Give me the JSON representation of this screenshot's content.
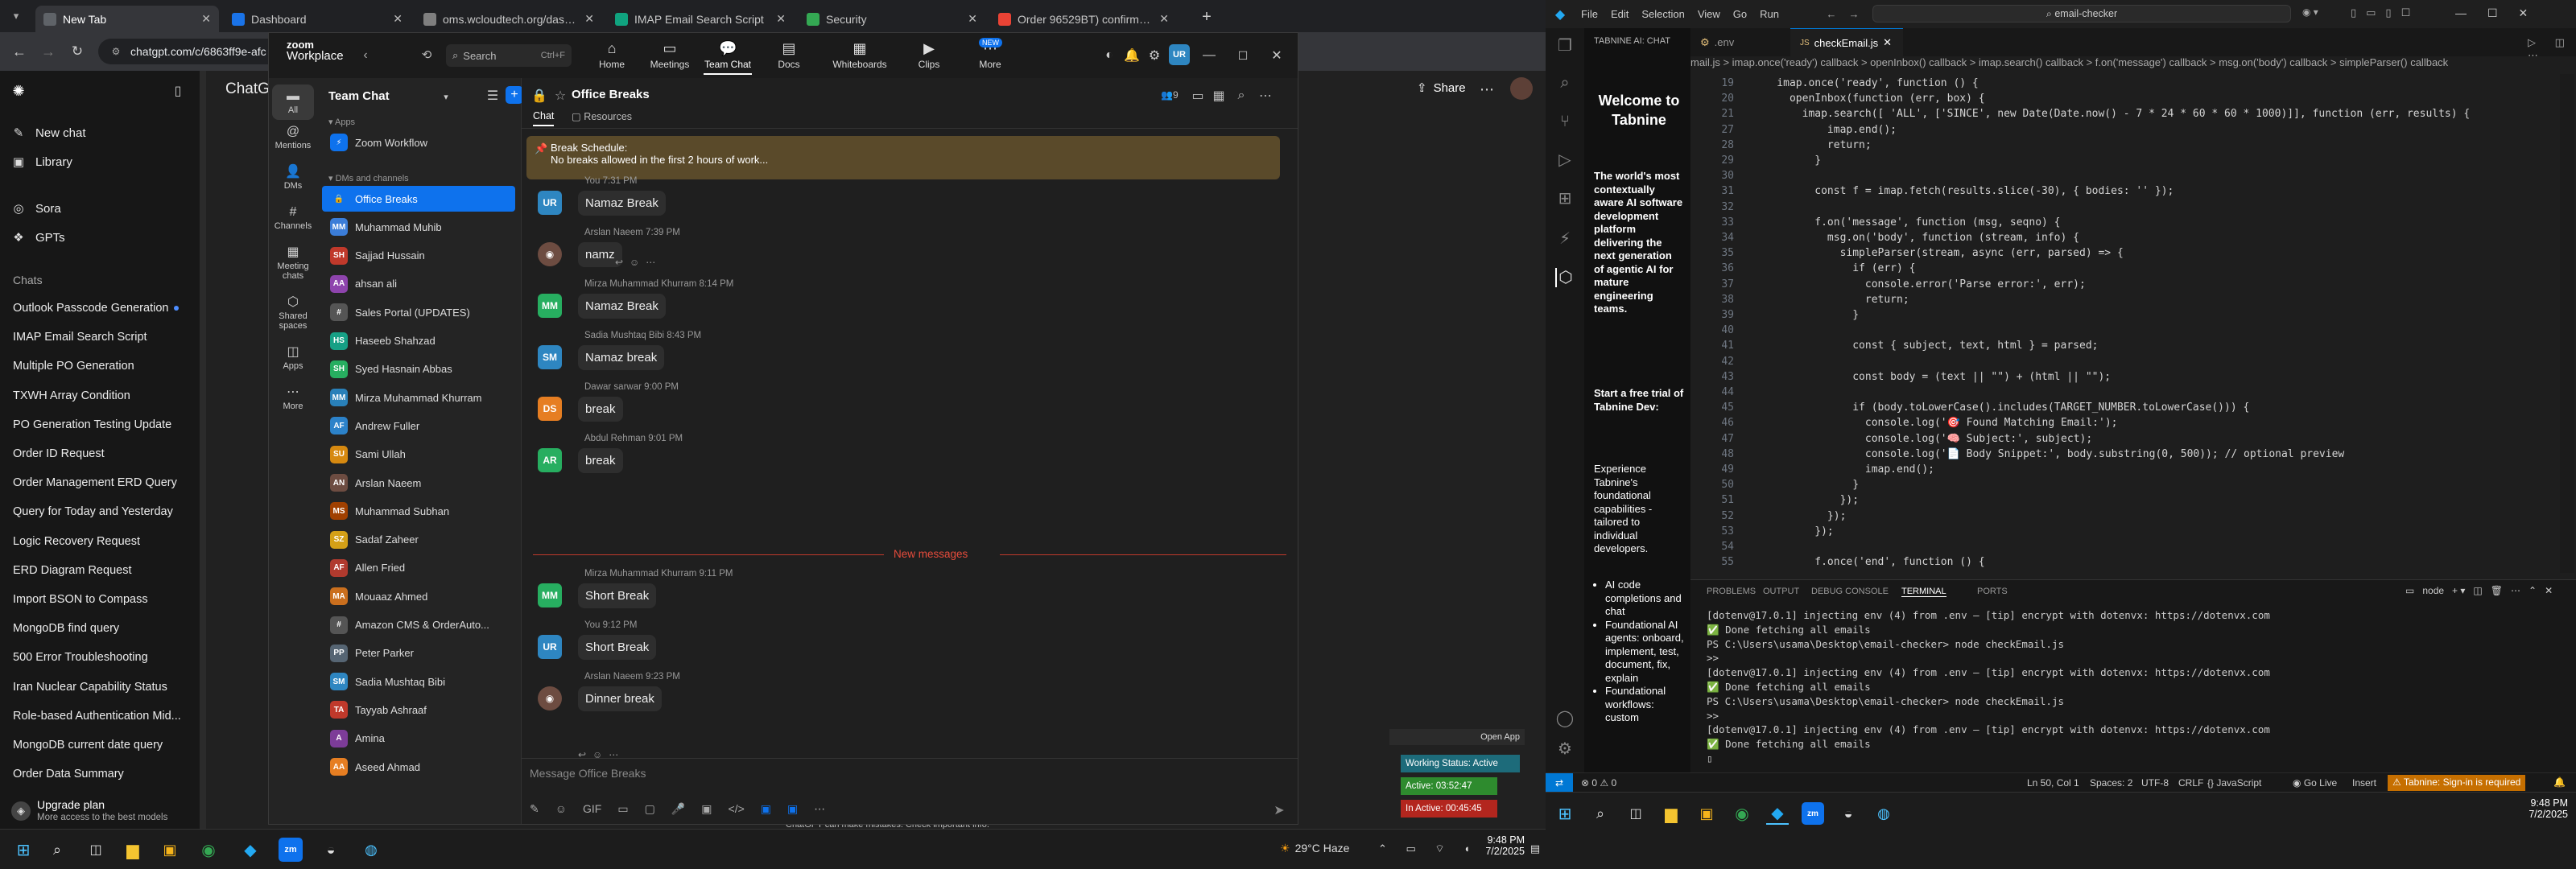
{
  "browser": {
    "tabs": [
      {
        "title": "New Tab",
        "color": "#5f6368"
      },
      {
        "title": "Dashboard",
        "color": "#1a73e8"
      },
      {
        "title": "oms.wcloudtech.org/dashboard",
        "color": "#7f7f7f"
      },
      {
        "title": "IMAP Email Search Script",
        "color": "#10a37f"
      },
      {
        "title": "Security",
        "color": "#34a853"
      },
      {
        "title": "Order 96529BT) confirmed - us",
        "color": "#ea4335"
      }
    ],
    "url": "chatgpt.com/c/6863ff9e-afc"
  },
  "chatgpt": {
    "brand": "ChatG",
    "new_chat": "New chat",
    "library": "Library",
    "sora": "Sora",
    "gpts": "GPTs",
    "chats_heading": "Chats",
    "history": [
      "Outlook Passcode Generation",
      "IMAP Email Search Script",
      "Multiple PO Generation",
      "TXWH Array Condition",
      "PO Generation Testing Update",
      "Order ID Request",
      "Order Management ERD Query",
      "Query for Today and Yesterday",
      "Logic Recovery Request",
      "ERD Diagram Request",
      "Import BSON to Compass",
      "MongoDB find query",
      "500 Error Troubleshooting",
      "Iran Nuclear Capability Status",
      "Role-based Authentication Mid...",
      "MongoDB current date query",
      "Order Data Summary"
    ],
    "upgrade_title": "Upgrade plan",
    "upgrade_sub": "More access to the best models",
    "share": "Share",
    "disclaimer": "ChatGPT can make mistakes. Check important info."
  },
  "zoom": {
    "logo_line1": "zoom",
    "logo_line2": "Workplace",
    "search_placeholder": "Search",
    "search_shortcut": "Ctrl+F",
    "nav": [
      "Home",
      "Meetings",
      "Team Chat",
      "Docs",
      "Whiteboards",
      "Clips",
      "More"
    ],
    "new_badge": "NEW",
    "avatar": "UR",
    "rail": [
      "All",
      "Mentions",
      "DMs",
      "Channels",
      "Meeting chats",
      "Shared spaces",
      "Apps",
      "More"
    ],
    "list_title": "Team Chat",
    "sections": {
      "apps": "Apps",
      "dms": "DMs and channels"
    },
    "app_items": [
      {
        "name": "Zoom Workflow",
        "initials": "",
        "color": "#0e72ed"
      }
    ],
    "contacts": [
      {
        "name": "Office Breaks",
        "initials": "",
        "color": "#0e72ed"
      },
      {
        "name": "Muhammad Muhib",
        "initials": "MM",
        "color": "#3b7dd8"
      },
      {
        "name": "Sajjad Hussain",
        "initials": "SH",
        "color": "#c0392b"
      },
      {
        "name": "ahsan ali",
        "initials": "AA",
        "color": "#8e44ad"
      },
      {
        "name": "Sales Portal (UPDATES)",
        "initials": "",
        "color": "#555"
      },
      {
        "name": "Haseeb Shahzad",
        "initials": "HS",
        "color": "#16a085"
      },
      {
        "name": "Syed Hasnain Abbas",
        "initials": "SH",
        "color": "#27ae60"
      },
      {
        "name": "Mirza Muhammad Khurram",
        "initials": "MM",
        "color": "#2980b9"
      },
      {
        "name": "Andrew Fuller",
        "initials": "AF",
        "color": "#2c82c9"
      },
      {
        "name": "Sami Ullah",
        "initials": "SU",
        "color": "#d68910"
      },
      {
        "name": "Arslan Naeem",
        "initials": "AN",
        "color": "#6d4c41"
      },
      {
        "name": "Muhammad Subhan",
        "initials": "MS",
        "color": "#a04000"
      },
      {
        "name": "Sadaf Zaheer",
        "initials": "SZ",
        "color": "#d4a017"
      },
      {
        "name": "Allen Fried",
        "initials": "AF",
        "color": "#b03a2e"
      },
      {
        "name": "Mouaaz Ahmed",
        "initials": "MA",
        "color": "#ca6f1e"
      },
      {
        "name": "Amazon CMS & OrderAuto...",
        "initials": "",
        "color": "#555"
      },
      {
        "name": "Peter Parker",
        "initials": "PP",
        "color": "#566573"
      },
      {
        "name": "Sadia Mushtaq Bibi",
        "initials": "SM",
        "color": "#2e86c1"
      },
      {
        "name": "Tayyab Ashraaf",
        "initials": "TA",
        "color": "#c0392b"
      },
      {
        "name": "Amina",
        "initials": "A",
        "color": "#7d3c98"
      },
      {
        "name": "Aseed Ahmad",
        "initials": "AA",
        "color": "#e67e22"
      }
    ],
    "chat_title": "Office Breaks",
    "member_count": "9",
    "chat_tabs": [
      "Chat",
      "Resources"
    ],
    "banner_title": "Break Schedule:",
    "banner_text": "No breaks allowed in the first 2 hours of work...",
    "messages": [
      {
        "who": "You 7:31 PM",
        "text": "Namaz Break",
        "initials": "UR",
        "color": "#2e86c1"
      },
      {
        "who": "Arslan Naeem 7:39 PM",
        "text": "namz",
        "initials": "",
        "color": "#6d4c41"
      },
      {
        "who": "Mirza Muhammad Khurram 8:14 PM",
        "text": "Namaz Break",
        "initials": "MM",
        "color": "#27ae60"
      },
      {
        "who": "Sadia Mushtaq Bibi 8:43 PM",
        "text": "Namaz break",
        "initials": "SM",
        "color": "#2e86c1"
      },
      {
        "who": "Dawar sarwar 9:00 PM",
        "text": "break",
        "initials": "DS",
        "color": "#e67e22"
      },
      {
        "who": "Abdul Rehman 9:01 PM",
        "text": "break",
        "initials": "AR",
        "color": "#27ae60"
      },
      {
        "who": "Mirza Muhammad Khurram 9:11 PM",
        "text": "Short Break",
        "initials": "MM",
        "color": "#27ae60"
      },
      {
        "who": "You 9:12 PM",
        "text": "Short Break",
        "initials": "UR",
        "color": "#2e86c1"
      },
      {
        "who": "Arslan Naeem 9:23 PM",
        "text": "Dinner break",
        "initials": "",
        "color": "#6d4c41"
      }
    ],
    "new_messages": "New messages",
    "compose_placeholder": "Message Office Breaks"
  },
  "overlay": {
    "open_app": "Open App",
    "working_status": "Working Status: Active",
    "active": "Active: 03:52:47",
    "in_active": "In Active: 00:45:45"
  },
  "taskbar_left": {
    "weather": "29°C  Haze",
    "time": "9:48 PM",
    "date": "7/2/2025"
  },
  "vscode": {
    "menu": [
      "File",
      "Edit",
      "Selection",
      "View",
      "Go",
      "Run"
    ],
    "search": "email-checker",
    "tabnine_tab": "TABNINE AI: CHAT",
    "tabs": [
      ".env",
      "checkEmail.js"
    ],
    "breadcrumb": "mail.js > imap.once('ready') callback > openInbox() callback > imap.search() callback > f.on('message') callback > msg.on('body') callback > simpleParser() callback",
    "tabnine": {
      "welcome": "Welcome to Tabnine",
      "pitch": "The world's most contextually aware AI software development platform delivering the next generation of agentic AI for mature engineering teams.",
      "trial": "Start a free trial of Tabnine Dev:",
      "experience": "Experience Tabnine's foundational capabilities - tailored to individual developers.",
      "bullets": [
        "AI code completions and chat",
        "Foundational AI agents: onboard, implement, test, document, fix, explain",
        "Foundational workflows: custom"
      ]
    },
    "code": [
      {
        "n": "19",
        "t": "    imap.once('ready', function () {"
      },
      {
        "n": "20",
        "t": "      openInbox(function (err, box) {"
      },
      {
        "n": "21",
        "t": "        imap.search([ 'ALL', ['SINCE', new Date(Date.now() - 7 * 24 * 60 * 60 * 1000)]], function (err, results) {"
      },
      {
        "n": "27",
        "t": "            imap.end();"
      },
      {
        "n": "28",
        "t": "            return;"
      },
      {
        "n": "29",
        "t": "          }"
      },
      {
        "n": "30",
        "t": ""
      },
      {
        "n": "31",
        "t": "          const f = imap.fetch(results.slice(-30), { bodies: '' });"
      },
      {
        "n": "32",
        "t": ""
      },
      {
        "n": "33",
        "t": "          f.on('message', function (msg, seqno) {"
      },
      {
        "n": "34",
        "t": "            msg.on('body', function (stream, info) {"
      },
      {
        "n": "35",
        "t": "              simpleParser(stream, async (err, parsed) => {"
      },
      {
        "n": "36",
        "t": "                if (err) {"
      },
      {
        "n": "37",
        "t": "                  console.error('Parse error:', err);"
      },
      {
        "n": "38",
        "t": "                  return;"
      },
      {
        "n": "39",
        "t": "                }"
      },
      {
        "n": "40",
        "t": ""
      },
      {
        "n": "41",
        "t": "                const { subject, text, html } = parsed;"
      },
      {
        "n": "42",
        "t": ""
      },
      {
        "n": "43",
        "t": "                const body = (text || \"\") + (html || \"\");"
      },
      {
        "n": "44",
        "t": ""
      },
      {
        "n": "45",
        "t": "                if (body.toLowerCase().includes(TARGET_NUMBER.toLowerCase())) {"
      },
      {
        "n": "46",
        "t": "                  console.log('🎯 Found Matching Email:');"
      },
      {
        "n": "47",
        "t": "                  console.log('🧠 Subject:', subject);"
      },
      {
        "n": "48",
        "t": "                  console.log('📄 Body Snippet:', body.substring(0, 500)); // optional preview"
      },
      {
        "n": "49",
        "t": "                  imap.end();"
      },
      {
        "n": "50",
        "t": "                }"
      },
      {
        "n": "51",
        "t": "              });"
      },
      {
        "n": "52",
        "t": "            });"
      },
      {
        "n": "53",
        "t": "          });"
      },
      {
        "n": "54",
        "t": ""
      },
      {
        "n": "55",
        "t": "          f.once('end', function () {"
      }
    ],
    "panel_tabs": [
      "PROBLEMS",
      "OUTPUT",
      "DEBUG CONSOLE",
      "TERMINAL",
      "PORTS"
    ],
    "terminal_shell": "node",
    "terminal": [
      "[dotenv@17.0.1] injecting env (4) from .env – [tip] encrypt with dotenvx: https://dotenvx.com",
      "✅ Done fetching all emails",
      "PS C:\\Users\\usama\\Desktop\\email-checker> node checkEmail.js",
      ">>",
      "[dotenv@17.0.1] injecting env (4) from .env – [tip] encrypt with dotenvx: https://dotenvx.com",
      "✅ Done fetching all emails",
      "PS C:\\Users\\usama\\Desktop\\email-checker> node checkEmail.js",
      ">>",
      "[dotenv@17.0.1] injecting env (4) from .env – [tip] encrypt with dotenvx: https://dotenvx.com",
      "✅ Done fetching all emails"
    ],
    "status": {
      "errors": "0",
      "warnings": "0",
      "position": "Ln 50, Col 1",
      "spaces": "Spaces: 2",
      "encoding": "UTF-8",
      "eol": "CRLF",
      "lang": "{} JavaScript",
      "golive": "Go Live",
      "insert": "Insert",
      "tabnine": "Tabnine: Sign-in is required"
    }
  },
  "taskbar_right": {
    "time": "9:48 PM",
    "date": "7/2/2025"
  }
}
